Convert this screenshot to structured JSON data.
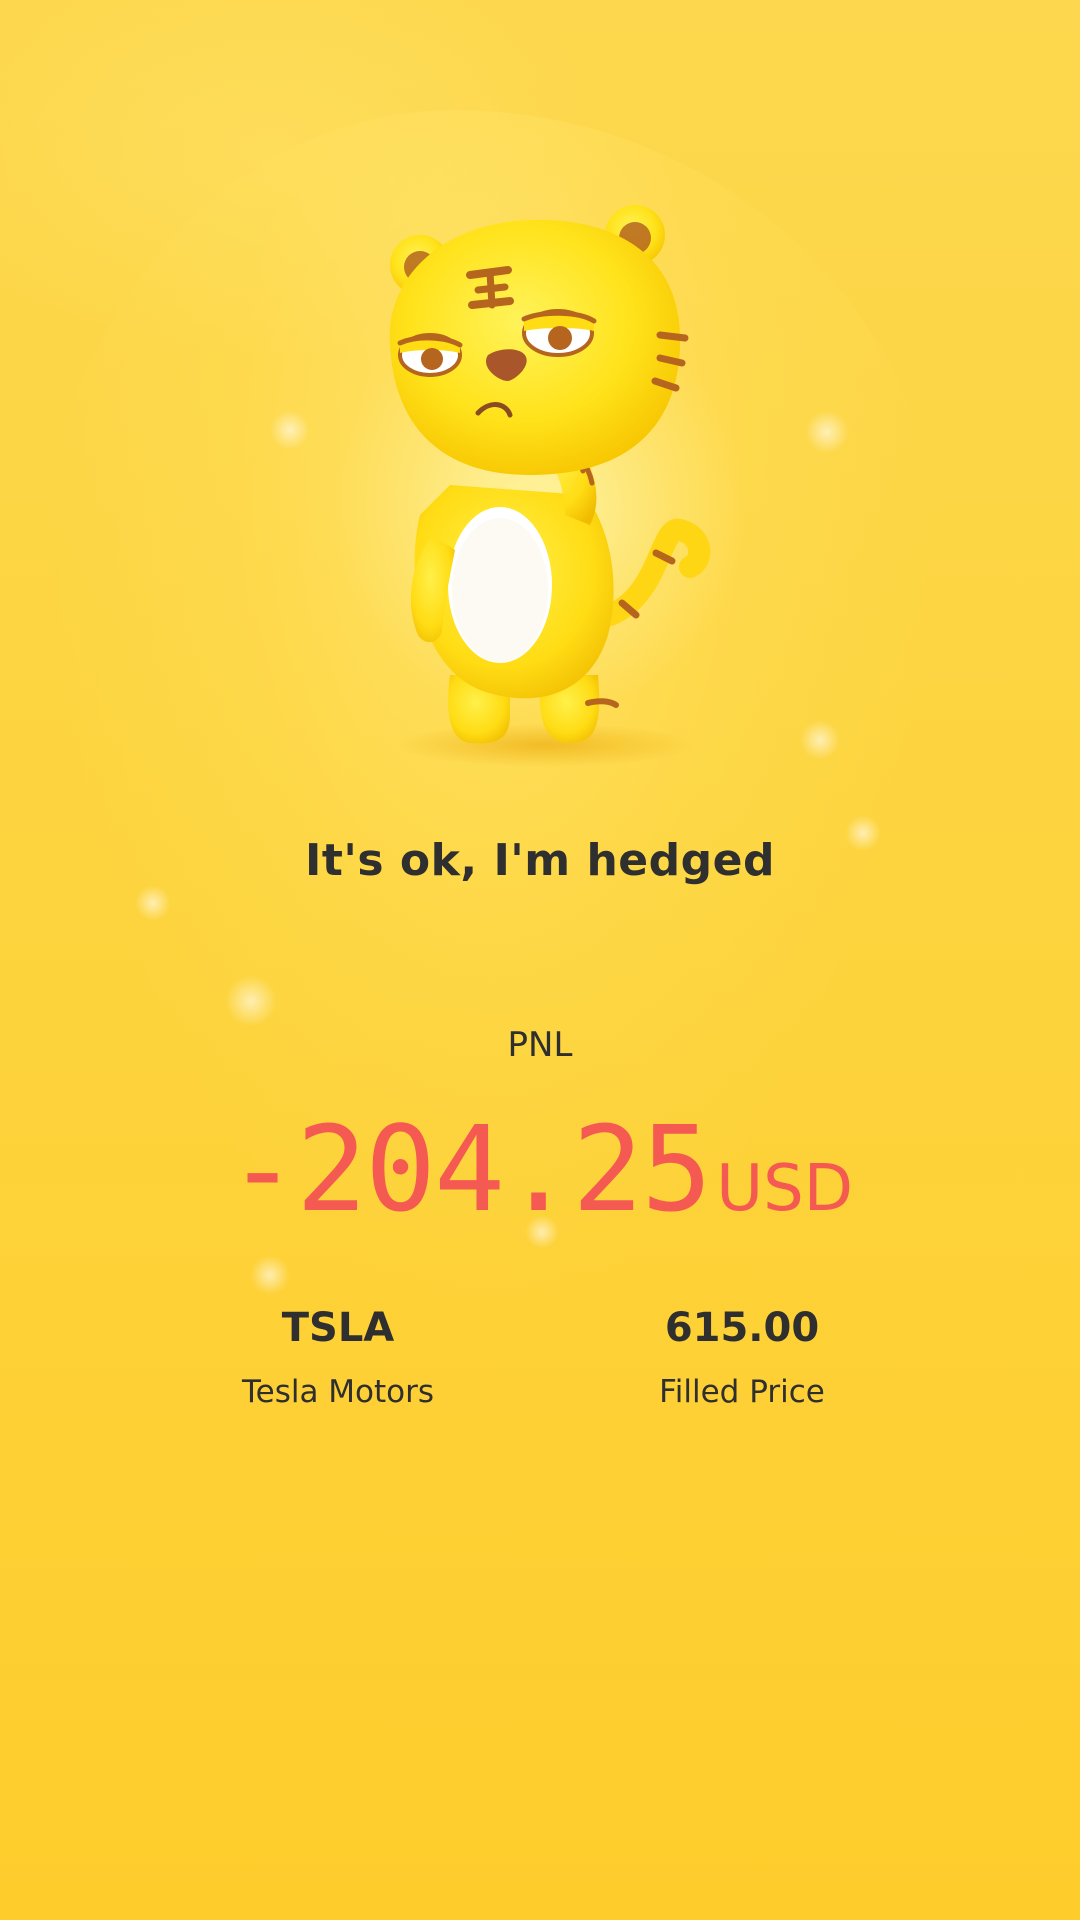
{
  "mascot": {
    "name": "tiger-mascot-icon",
    "description_visible": false
  },
  "message": "It's ok, I'm hedged",
  "pnl": {
    "label": "PNL",
    "value": "-204.25",
    "unit": "USD"
  },
  "stats": [
    {
      "value": "TSLA",
      "label": "Tesla Motors"
    },
    {
      "value": "615.00",
      "label": "Filled Price"
    }
  ],
  "colors": {
    "background": "#fdd43e",
    "loss": "#f55a52",
    "text": "#2f2f2f"
  }
}
